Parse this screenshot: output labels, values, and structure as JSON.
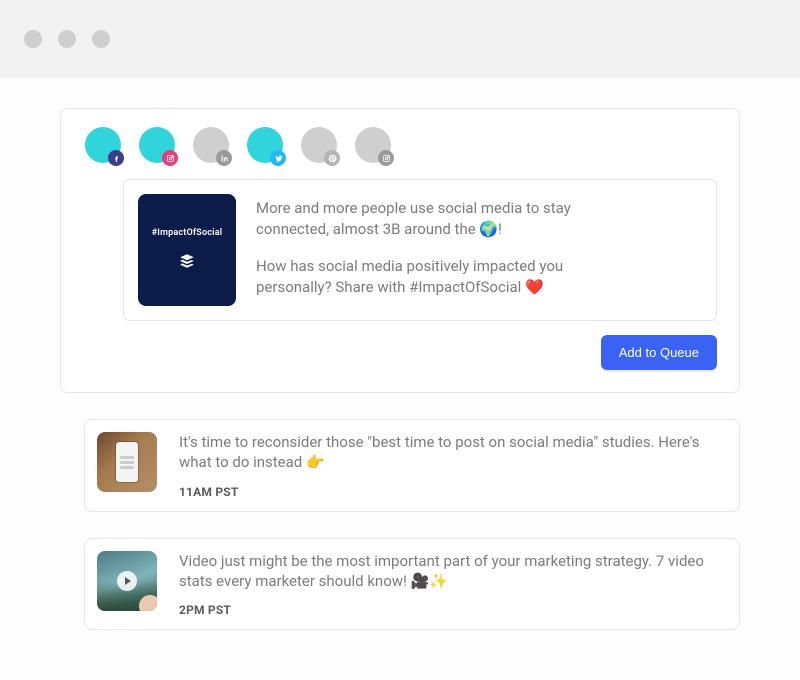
{
  "accounts": [
    {
      "network": "facebook",
      "active": true
    },
    {
      "network": "instagram",
      "active": true
    },
    {
      "network": "linkedin",
      "active": false
    },
    {
      "network": "twitter",
      "active": true
    },
    {
      "network": "pinterest",
      "active": false
    },
    {
      "network": "instagram",
      "active": false
    }
  ],
  "composer": {
    "thumb_hashtag": "#ImpactOfSocial",
    "paragraph1": "More and more people use social media to stay connected, almost 3B around the 🌍!",
    "paragraph2": "How has social media positively impacted you personally? Share with #ImpactOfSocial ❤️",
    "button_label": "Add to Queue"
  },
  "queue": [
    {
      "text": "It's time to reconsider those \"best time to post on social media\" studies. Here's what to do instead 👉",
      "time": "11AM PST"
    },
    {
      "text": "Video just might be the most important part of your marketing strategy. 7 video stats every marketer should know! 🎥✨",
      "time": "2PM PST"
    }
  ]
}
